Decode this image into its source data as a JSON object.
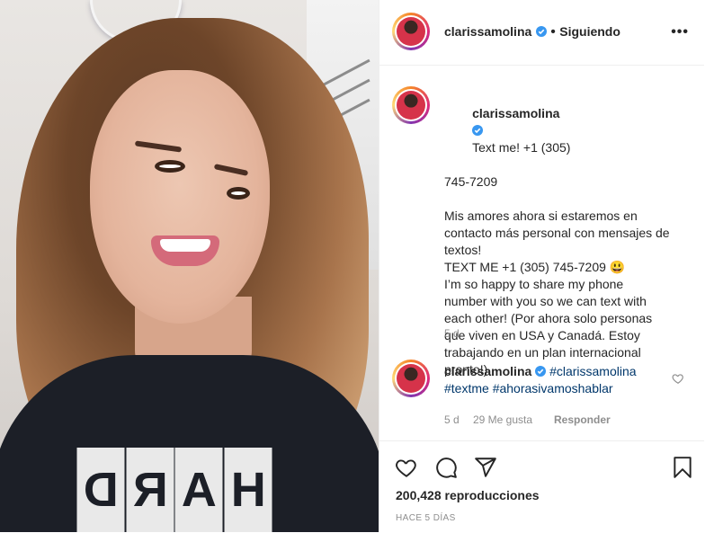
{
  "post": {
    "username": "clarissamolina",
    "separator": "•",
    "follow_status": "Siguiendo",
    "more_label": "•••"
  },
  "caption": {
    "username": "clarissamolina",
    "lines": [
      "Text me! +1 (305)",
      "745-7209",
      "",
      "Mis amores ahora si estaremos en",
      "contacto más personal con mensajes de",
      "textos!",
      "TEXT ME +1 (305) 745-7209 😃",
      "I’m so happy to share my phone",
      "number with you so we can text with",
      "each other! (Por ahora solo personas",
      "que viven en USA y Canadá. Estoy",
      "trabajando en un plan internacional",
      "pronto!)"
    ],
    "age": "5 d"
  },
  "comment": {
    "username": "clarissamolina",
    "hashtag1": "#clarissamolina",
    "hashtag2": "#textme",
    "hashtag3": "#ahorasivamoshablar",
    "age": "5 d",
    "likes": "29 Me gusta",
    "reply_label": "Responder"
  },
  "stats": {
    "views": "200,428 reproducciones",
    "time_ago": "HACE 5 DÍAS"
  },
  "media": {
    "shirt_letters": [
      "H",
      "A",
      "R",
      "D"
    ]
  },
  "colors": {
    "verified_blue": "#3897f0",
    "hashtag_blue": "#00376b",
    "meta_gray": "#8e8e8e",
    "border": "#efefef"
  },
  "icons": [
    "verified-badge-icon",
    "more-options-icon",
    "heart-icon",
    "comment-icon",
    "share-icon",
    "bookmark-icon",
    "small-heart-icon"
  ]
}
